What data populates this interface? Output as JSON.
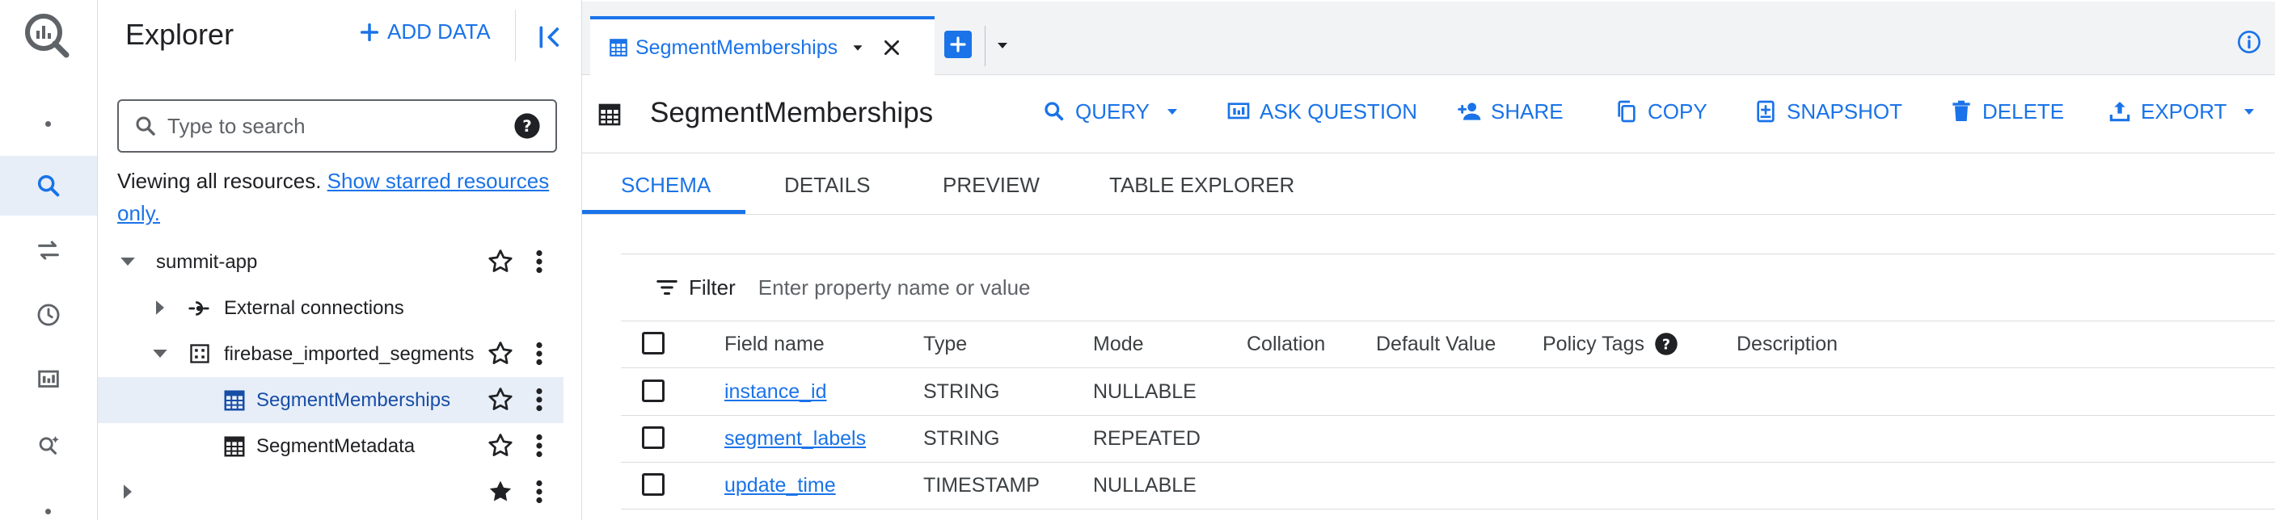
{
  "explorer": {
    "title": "Explorer",
    "add_data_label": "ADD DATA",
    "search_placeholder": "Type to search",
    "viewing_text": "Viewing all resources. ",
    "starred_link": "Show starred resources only.",
    "tree": [
      {
        "label": "summit-app",
        "level": 0,
        "expanded": true,
        "starred": false
      },
      {
        "label": "External connections",
        "level": 1,
        "expanded": false,
        "icon": "connection-icon"
      },
      {
        "label": "firebase_imported_segments",
        "level": 1,
        "expanded": true,
        "icon": "dataset-icon",
        "starred": false
      },
      {
        "label": "SegmentMemberships",
        "level": 2,
        "selected": true,
        "icon": "table-icon",
        "starred": false
      },
      {
        "label": "SegmentMetadata",
        "level": 2,
        "icon": "table-icon",
        "starred": false
      },
      {
        "label": "",
        "level": 0,
        "expanded": false,
        "starred": true
      }
    ]
  },
  "tabs": {
    "active_tab_label": "SegmentMemberships"
  },
  "toolbar": {
    "table_title": "SegmentMemberships",
    "query": "QUERY",
    "ask_question": "ASK QUESTION",
    "share": "SHARE",
    "copy": "COPY",
    "snapshot": "SNAPSHOT",
    "delete": "DELETE",
    "export": "EXPORT"
  },
  "subtabs": [
    "SCHEMA",
    "DETAILS",
    "PREVIEW",
    "TABLE EXPLORER"
  ],
  "filter": {
    "label": "Filter",
    "placeholder": "Enter property name or value"
  },
  "schema": {
    "columns": [
      "Field name",
      "Type",
      "Mode",
      "Collation",
      "Default Value",
      "Policy Tags",
      "Description"
    ],
    "rows": [
      {
        "field": "instance_id",
        "type": "STRING",
        "mode": "NULLABLE"
      },
      {
        "field": "segment_labels",
        "type": "STRING",
        "mode": "REPEATED"
      },
      {
        "field": "update_time",
        "type": "TIMESTAMP",
        "mode": "NULLABLE"
      }
    ]
  },
  "colors": {
    "accent": "#1a73e8",
    "selected_bg": "#e8eef8",
    "text": "#202124",
    "muted": "#5f6368"
  }
}
